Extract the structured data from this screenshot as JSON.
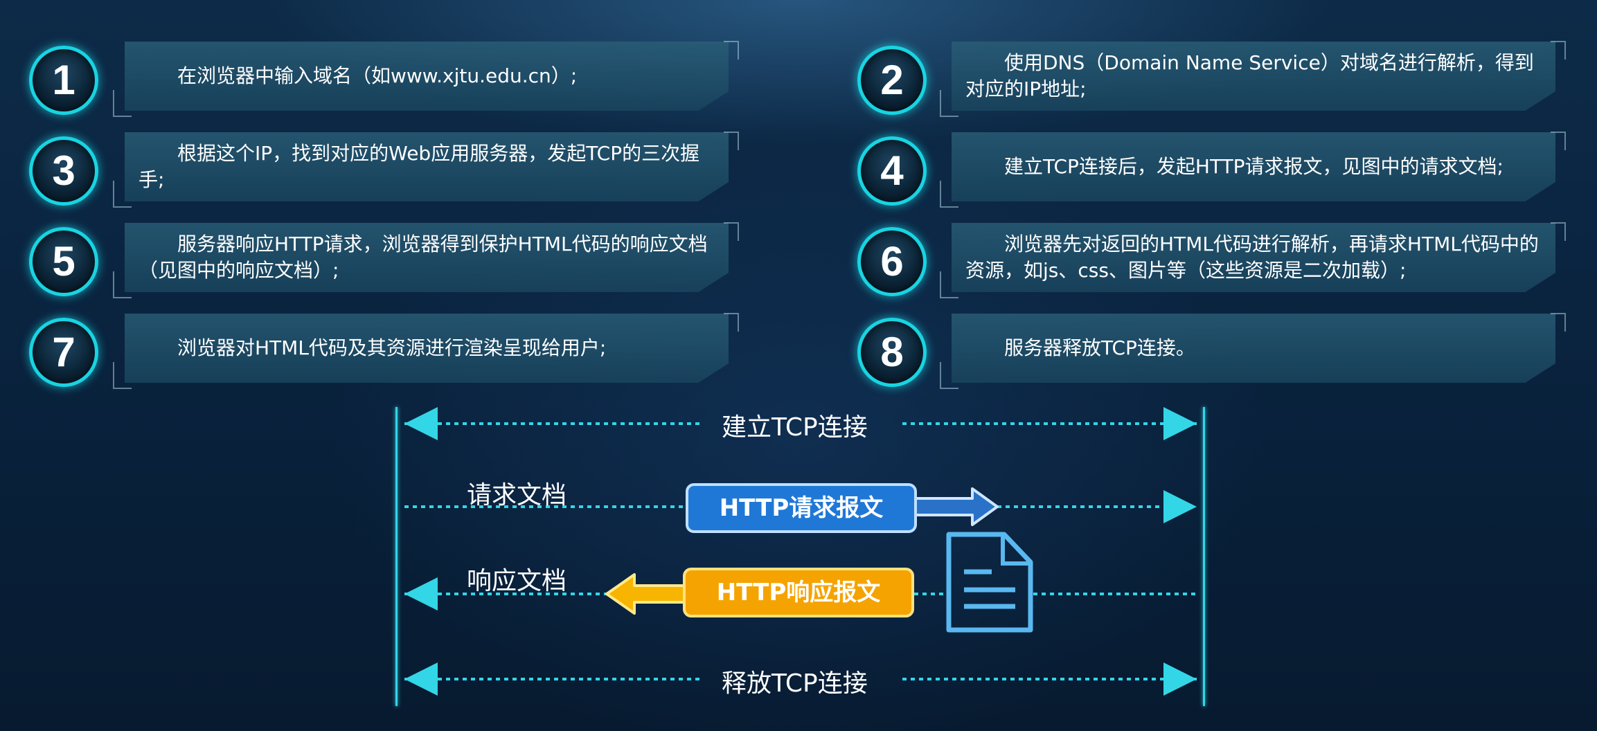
{
  "steps": [
    {
      "num": "1",
      "text": "在浏览器中输入域名（如www.xjtu.edu.cn）;"
    },
    {
      "num": "2",
      "text": "使用DNS（Domain Name Service）对域名进行解析，得到对应的IP地址;"
    },
    {
      "num": "3",
      "text": "根据这个IP，找到对应的Web应用服务器，发起TCP的三次握手;"
    },
    {
      "num": "4",
      "text": "建立TCP连接后，发起HTTP请求报文，见图中的请求文档;"
    },
    {
      "num": "5",
      "text": "服务器响应HTTP请求，浏览器得到保护HTML代码的响应文档（见图中的响应文档）;"
    },
    {
      "num": "6",
      "text": "浏览器先对返回的HTML代码进行解析，再请求HTML代码中的资源，如js、css、图片等（这些资源是二次加载）;"
    },
    {
      "num": "7",
      "text": "浏览器对HTML代码及其资源进行渲染呈现给用户;"
    },
    {
      "num": "8",
      "text": "服务器释放TCP连接。"
    }
  ],
  "diagram": {
    "establish": "建立TCP连接",
    "request_doc": "请求文档",
    "http_request": "HTTP请求报文",
    "response_doc": "响应文档",
    "http_response": "HTTP响应报文",
    "release": "释放TCP连接"
  },
  "colors": {
    "cyan": "#33d6e6",
    "request_blue": "#1f78d6",
    "response_orange": "#f5a300",
    "doc_icon": "#5ab8f0"
  }
}
